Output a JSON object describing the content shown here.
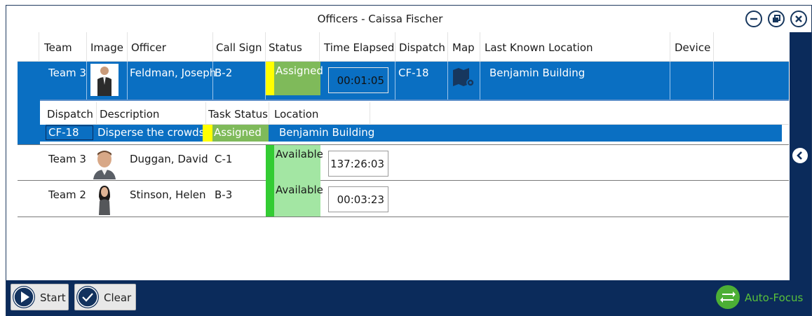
{
  "window": {
    "title": "Officers - Caissa Fischer"
  },
  "columns": [
    "Team",
    "Image",
    "Officer",
    "Call Sign",
    "Status",
    "Time Elapsed",
    "Dispatch",
    "Map",
    "Last Known Location",
    "Device"
  ],
  "rows": [
    {
      "team": "Team 3",
      "officer": "Feldman, Joseph",
      "call_sign": "B-2",
      "status": "Assigned",
      "time": "00:01:05",
      "dispatch": "CF-18",
      "location": "Benjamin Building",
      "status_color": "#ffff00"
    },
    {
      "team": "Team 3",
      "officer": "Duggan, David",
      "call_sign": "C-1",
      "status": "Available",
      "time": "137:26:03",
      "status_color": "#33cc33"
    },
    {
      "team": "Team 2",
      "officer": "Stinson, Helen",
      "call_sign": "B-3",
      "status": "Available",
      "time": "00:03:23",
      "status_color": "#33cc33"
    }
  ],
  "sub_grid": {
    "columns": [
      "Dispatch",
      "Description",
      "Task Status",
      "Location"
    ],
    "row": {
      "dispatch": "CF-18",
      "description": "Disperse the crowds.",
      "task_status": "Assigned",
      "location": "Benjamin Building"
    }
  },
  "bottom": {
    "start_label": "Start",
    "clear_label": "Clear",
    "autofocus_label": "Auto-Focus"
  },
  "colors": {
    "accent_blue": "#0a6fc2",
    "navy": "#0b2b5b",
    "assigned_green": "#7fba5a",
    "available_green": "#a3e6a3",
    "auto_focus_green": "#4caf35"
  }
}
